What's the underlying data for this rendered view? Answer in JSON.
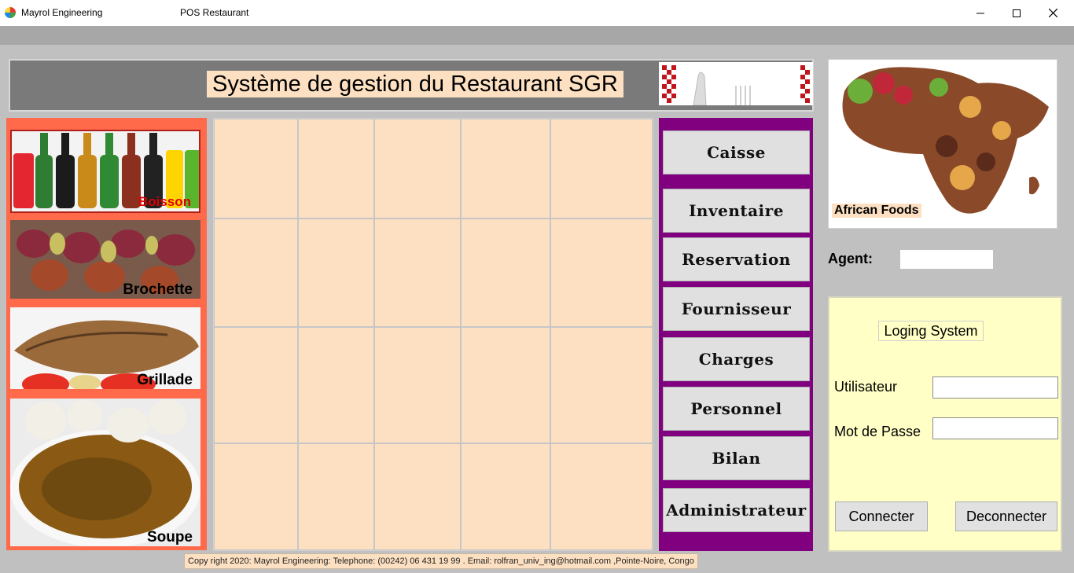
{
  "titlebar": {
    "app_name": "Mayrol Engineering",
    "window_title": "POS Restaurant"
  },
  "header": {
    "title": "Système de gestion du Restaurant SGR"
  },
  "categories": [
    {
      "label": "Boisson"
    },
    {
      "label": "Brochette"
    },
    {
      "label": "Grillade"
    },
    {
      "label": "Soupe"
    }
  ],
  "menu": [
    {
      "label": "Caisse"
    },
    {
      "label": "Inventaire"
    },
    {
      "label": "Reservation"
    },
    {
      "label": "Fournisseur"
    },
    {
      "label": "Charges"
    },
    {
      "label": "Personnel"
    },
    {
      "label": "Bilan"
    },
    {
      "label": "Administrateur"
    }
  ],
  "promo": {
    "label": "African Foods"
  },
  "agent": {
    "label": "Agent:",
    "value": ""
  },
  "login": {
    "title": "Loging System",
    "user_label": "Utilisateur",
    "user_value": "",
    "password_label": "Mot de Passe",
    "password_value": "",
    "connect_label": "Connecter",
    "disconnect_label": "Deconnecter"
  },
  "footer": {
    "text": "Copy right 2020: Mayrol Engineering: Telephone: (00242) 06 431 19 99 . Email:  rolfran_univ_ing@hotmail.com ,Pointe-Noire, Congo"
  },
  "colors": {
    "peach": "#fde0c2",
    "purple": "#800080",
    "coral": "#ff6a4a",
    "login_bg": "#ffffc6"
  }
}
